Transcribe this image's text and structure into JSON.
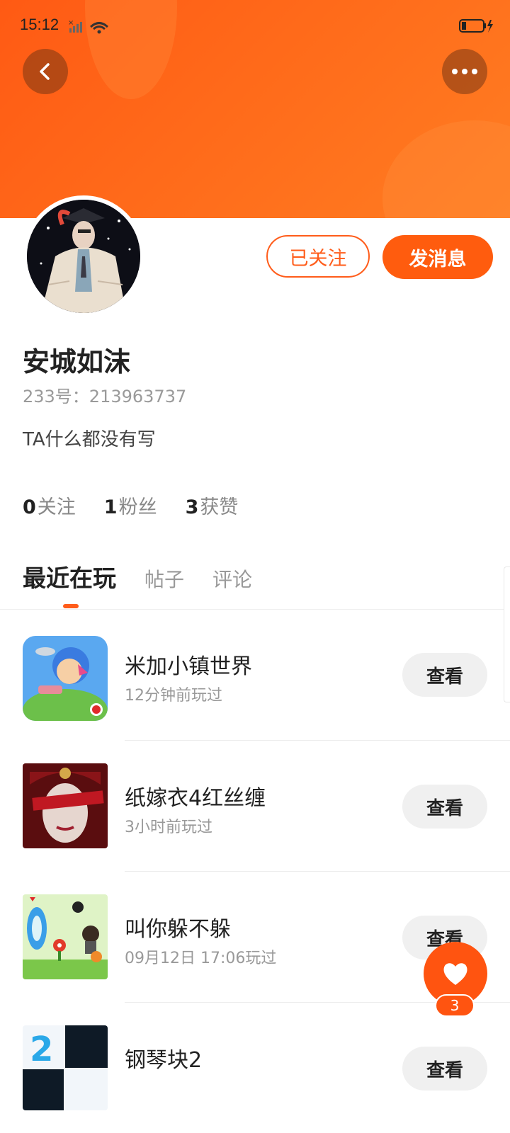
{
  "status_bar": {
    "time": "15:12"
  },
  "header": {
    "accent": "#ff5a14"
  },
  "profile": {
    "follow_state_label": "已关注",
    "message_label": "发消息",
    "username": "安城如沫",
    "uid_text": "233号：213963737",
    "bio": "TA什么都没有写",
    "stats": [
      {
        "count": "0",
        "label": "关注"
      },
      {
        "count": "1",
        "label": "粉丝"
      },
      {
        "count": "3",
        "label": "获赞"
      }
    ]
  },
  "tabs": [
    {
      "label": "最近在玩",
      "active": true
    },
    {
      "label": "帖子",
      "active": false
    },
    {
      "label": "评论",
      "active": false
    }
  ],
  "games": [
    {
      "title": "米加小镇世界",
      "subtitle": "12分钟前玩过",
      "button": "查看"
    },
    {
      "title": "纸嫁衣4红丝缠",
      "subtitle": "3小时前玩过",
      "button": "查看"
    },
    {
      "title": "叫你躲不躲",
      "subtitle": "09月12日 17:06玩过",
      "button": "查看"
    },
    {
      "title": "钢琴块2",
      "subtitle": "",
      "button": "查看"
    }
  ],
  "like_fab": {
    "count": "3"
  }
}
